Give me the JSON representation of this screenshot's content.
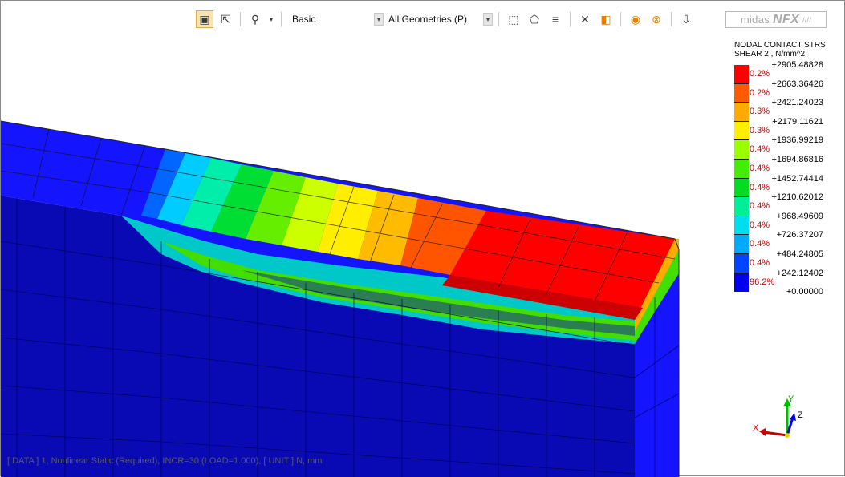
{
  "toolbar": {
    "display_style": "Basic",
    "geometry_filter": "All Geometries (P)"
  },
  "brand": {
    "left": "midas",
    "right": "NFX"
  },
  "legend": {
    "title_line1": "NODAL CONTACT STRS",
    "title_line2": "SHEAR 2 , N/mm^2",
    "bands": [
      {
        "color": "#ff0000",
        "percent": "0.2%"
      },
      {
        "color": "#ff5a00",
        "percent": "0.2%"
      },
      {
        "color": "#ffaa00",
        "percent": "0.3%"
      },
      {
        "color": "#ffee00",
        "percent": "0.3%"
      },
      {
        "color": "#9aff00",
        "percent": "0.4%"
      },
      {
        "color": "#44ee00",
        "percent": "0.4%"
      },
      {
        "color": "#00dd22",
        "percent": "0.4%"
      },
      {
        "color": "#00ee99",
        "percent": "0.4%"
      },
      {
        "color": "#00ddee",
        "percent": "0.4%"
      },
      {
        "color": "#00aaff",
        "percent": "0.4%"
      },
      {
        "color": "#0044ff",
        "percent": "0.4%"
      },
      {
        "color": "#0000ee",
        "percent": "96.2%"
      }
    ],
    "values": [
      "+2905.48828",
      "+2663.36426",
      "+2421.24023",
      "+2179.11621",
      "+1936.99219",
      "+1694.86816",
      "+1452.74414",
      "+1210.62012",
      "+968.49609",
      "+726.37207",
      "+484.24805",
      "+242.12402",
      "+0.00000"
    ]
  },
  "status": {
    "text": "[ DATA ]  1, Nonlinear Static (Required), INCR=30 (LOAD=1.000),  [ UNIT ]  N, mm"
  },
  "triad": {
    "x_label": "X",
    "y_label": "Y",
    "z_label": "Z"
  },
  "colors": {
    "deep_blue": "#0a0ab4",
    "blue": "#1414ff"
  }
}
